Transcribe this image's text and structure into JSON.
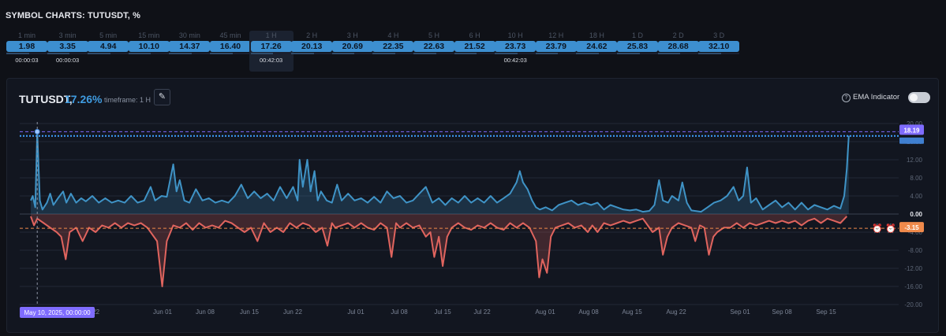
{
  "page": {
    "title": "SYMBOL CHARTS: TUTUSDT, %"
  },
  "timeframes": [
    {
      "label": "1 min",
      "value": "1.98",
      "timer": "00:00:03"
    },
    {
      "label": "3 min",
      "value": "3.35",
      "timer": "00:00:03"
    },
    {
      "label": "5 min",
      "value": "4.94",
      "timer": ""
    },
    {
      "label": "15 min",
      "value": "10.10",
      "timer": ""
    },
    {
      "label": "30 min",
      "value": "14.37",
      "timer": ""
    },
    {
      "label": "45 min",
      "value": "16.40",
      "timer": ""
    },
    {
      "label": "1 H",
      "value": "17.26",
      "timer": "00:42:03",
      "active": true
    },
    {
      "label": "2 H",
      "value": "20.13",
      "timer": ""
    },
    {
      "label": "3 H",
      "value": "20.69",
      "timer": ""
    },
    {
      "label": "4 H",
      "value": "22.35",
      "timer": ""
    },
    {
      "label": "5 H",
      "value": "22.63",
      "timer": ""
    },
    {
      "label": "6 H",
      "value": "21.52",
      "timer": ""
    },
    {
      "label": "10 H",
      "value": "23.73",
      "timer": "00:42:03"
    },
    {
      "label": "12 H",
      "value": "23.79",
      "timer": ""
    },
    {
      "label": "18 H",
      "value": "24.62",
      "timer": ""
    },
    {
      "label": "1 D",
      "value": "25.83",
      "timer": ""
    },
    {
      "label": "2 D",
      "value": "28.68",
      "timer": ""
    },
    {
      "label": "3 D",
      "value": "32.10",
      "timer": ""
    }
  ],
  "chart": {
    "symbol": "TUTUSDT,",
    "percent": "17.26%",
    "timeframe_label": "timeframe: 1 H",
    "ema_label": "EMA Indicator",
    "ema_enabled": false
  },
  "colors": {
    "positive": "#3f93c6",
    "negative": "#e0645e",
    "max_line": "#7f6cff",
    "current_line": "#3fa0ff",
    "min_line": "#f08a4b"
  },
  "icons": [
    "pen-icon",
    "info-icon",
    "alarm-add-icon",
    "alarm-remove-icon"
  ],
  "chart_data": {
    "type": "area",
    "x_start": "2025-05-10 00:00",
    "x_end": "2025-09-21 00:00",
    "y_ticks": [
      "20.00",
      "16.00",
      "12.00",
      "8.00",
      "4.00",
      "0.00",
      "-4.00",
      "-8.00",
      "-12.00",
      "-16.00",
      "-20.00"
    ],
    "ylim": [
      -20,
      20
    ],
    "x_ticks": [
      "May 22",
      "Jun 01",
      "Jun 08",
      "Jun 15",
      "Jun 22",
      "Jul 01",
      "Jul 08",
      "Jul 15",
      "Jul 22",
      "Aug 01",
      "Aug 08",
      "Aug 15",
      "Aug 22",
      "Sep 01",
      "Sep 08",
      "Sep 15"
    ],
    "crosshair_label": "May 10, 2025, 00:00:00",
    "max_value": 18.19,
    "max_label": "18.19",
    "current_value": 17.26,
    "min_value": -3.15,
    "min_label": "-3.15",
    "series": [
      {
        "sign": "positive",
        "points": [
          [
            0,
            3
          ],
          [
            0.3,
            4
          ],
          [
            0.7,
            1.5
          ],
          [
            1,
            18.2
          ],
          [
            1.4,
            3
          ],
          [
            1.8,
            1
          ],
          [
            2.5,
            2.5
          ],
          [
            3,
            4.5
          ],
          [
            3.5,
            2
          ],
          [
            4.2,
            3.5
          ],
          [
            5,
            5
          ],
          [
            5.5,
            2.5
          ],
          [
            6.2,
            4.5
          ],
          [
            7,
            2.5
          ],
          [
            7.8,
            3.5
          ],
          [
            8.5,
            2.8
          ],
          [
            9.5,
            4
          ],
          [
            10.5,
            2.5
          ],
          [
            11.5,
            3.5
          ],
          [
            12.5,
            2.5
          ],
          [
            13.5,
            3
          ],
          [
            14.5,
            2.5
          ],
          [
            15.5,
            4
          ],
          [
            16.5,
            2.5
          ],
          [
            17.5,
            3
          ],
          [
            18.5,
            6
          ],
          [
            19.2,
            3
          ],
          [
            20.2,
            4
          ],
          [
            21,
            3.8
          ],
          [
            22,
            11
          ],
          [
            22.5,
            5
          ],
          [
            23,
            7.5
          ],
          [
            23.7,
            3
          ],
          [
            24.5,
            2.5
          ],
          [
            25.5,
            5.5
          ],
          [
            26.5,
            3
          ],
          [
            27.5,
            3.5
          ],
          [
            28.5,
            2.5
          ],
          [
            29.5,
            3
          ],
          [
            30.5,
            2.5
          ],
          [
            31.5,
            4
          ],
          [
            32.5,
            6.5
          ],
          [
            33.5,
            3.5
          ],
          [
            34.5,
            5
          ],
          [
            35.5,
            3.5
          ],
          [
            36.5,
            4.5
          ],
          [
            37.5,
            3
          ],
          [
            38.5,
            6
          ],
          [
            39.5,
            3.5
          ],
          [
            40.5,
            6
          ],
          [
            41.2,
            3
          ],
          [
            41.5,
            12
          ],
          [
            42,
            6
          ],
          [
            42.7,
            12
          ],
          [
            43.2,
            5
          ],
          [
            43.8,
            9.5
          ],
          [
            44.3,
            3
          ],
          [
            44.8,
            5
          ],
          [
            45.7,
            3
          ],
          [
            46.5,
            2.5
          ],
          [
            47.3,
            6.5
          ],
          [
            48,
            3
          ],
          [
            49,
            4.5
          ],
          [
            50,
            3
          ],
          [
            51,
            3.5
          ],
          [
            52,
            2.5
          ],
          [
            53,
            3.8
          ],
          [
            54,
            2.5
          ],
          [
            55,
            5
          ],
          [
            56,
            3.5
          ],
          [
            57,
            4
          ],
          [
            58,
            2.5
          ],
          [
            59,
            3
          ],
          [
            60,
            4.5
          ],
          [
            61,
            6
          ],
          [
            62,
            2.5
          ],
          [
            63,
            3.5
          ],
          [
            64,
            2
          ],
          [
            65,
            3.5
          ],
          [
            66,
            2.5
          ],
          [
            67,
            4
          ],
          [
            68,
            2.5
          ],
          [
            69,
            3.5
          ],
          [
            70,
            2.5
          ],
          [
            71,
            4
          ],
          [
            72,
            2.5
          ],
          [
            73,
            3.5
          ],
          [
            74,
            4.5
          ],
          [
            75,
            7
          ],
          [
            75.5,
            9.5
          ],
          [
            76,
            7
          ],
          [
            76.7,
            5.5
          ],
          [
            77.4,
            3
          ],
          [
            78,
            1.5
          ],
          [
            78.6,
            1
          ],
          [
            79.5,
            1.5
          ],
          [
            80.5,
            0.8
          ],
          [
            81.5,
            2
          ],
          [
            82.5,
            2.5
          ],
          [
            83.5,
            3
          ],
          [
            84.5,
            2
          ],
          [
            85.5,
            2.5
          ],
          [
            86.5,
            2
          ],
          [
            87.5,
            2.5
          ],
          [
            88.5,
            1
          ],
          [
            89.5,
            2
          ],
          [
            90.5,
            1.5
          ],
          [
            91.5,
            1
          ],
          [
            92.5,
            0.8
          ],
          [
            93.5,
            1
          ],
          [
            94.5,
            0.5
          ],
          [
            95.5,
            0.7
          ],
          [
            96.3,
            2
          ],
          [
            97,
            7.5
          ],
          [
            97.6,
            3
          ],
          [
            98.4,
            2.5
          ],
          [
            99,
            4
          ],
          [
            100,
            3
          ],
          [
            100.6,
            7
          ],
          [
            101.3,
            2.5
          ],
          [
            102,
            0.8
          ],
          [
            103.5,
            0.5
          ],
          [
            104.5,
            1.5
          ],
          [
            105.5,
            2.5
          ],
          [
            106.5,
            3
          ],
          [
            107.5,
            4
          ],
          [
            108.5,
            6
          ],
          [
            109.3,
            3
          ],
          [
            110,
            4
          ],
          [
            110.6,
            10.3
          ],
          [
            111.2,
            2.5
          ],
          [
            112,
            3.5
          ],
          [
            113,
            1
          ],
          [
            114,
            2
          ],
          [
            115,
            3
          ],
          [
            116,
            1.5
          ],
          [
            117,
            2.5
          ],
          [
            118,
            1
          ],
          [
            119,
            2.5
          ],
          [
            120,
            1
          ],
          [
            121,
            2
          ],
          [
            122,
            1.5
          ],
          [
            123,
            1
          ],
          [
            124,
            1.8
          ],
          [
            125,
            1.2
          ],
          [
            125.6,
            4
          ],
          [
            126,
            10
          ],
          [
            126.3,
            17.3
          ]
        ]
      },
      {
        "sign": "negative",
        "points": [
          [
            0,
            -0.5
          ],
          [
            0.5,
            -2.5
          ],
          [
            1,
            -1
          ],
          [
            2,
            -2
          ],
          [
            3,
            -3
          ],
          [
            4,
            -4
          ],
          [
            4.7,
            -5
          ],
          [
            5.4,
            -10
          ],
          [
            6,
            -4
          ],
          [
            7,
            -3
          ],
          [
            8,
            -6
          ],
          [
            9,
            -3
          ],
          [
            10,
            -4
          ],
          [
            11,
            -2.5
          ],
          [
            12,
            -3
          ],
          [
            13,
            -2
          ],
          [
            14,
            -3
          ],
          [
            15,
            -2
          ],
          [
            16,
            -2.5
          ],
          [
            17,
            -2
          ],
          [
            18,
            -3
          ],
          [
            19.5,
            -6
          ],
          [
            20.3,
            -16
          ],
          [
            21,
            -6
          ],
          [
            22,
            -2.5
          ],
          [
            23,
            -3
          ],
          [
            24,
            -2
          ],
          [
            25,
            -3.5
          ],
          [
            26,
            -2
          ],
          [
            27,
            -3
          ],
          [
            28,
            -2.5
          ],
          [
            29,
            -3
          ],
          [
            30,
            -1.5
          ],
          [
            31,
            -2
          ],
          [
            32,
            -3
          ],
          [
            33,
            -4
          ],
          [
            34,
            -3
          ],
          [
            35,
            -6
          ],
          [
            36,
            -2
          ],
          [
            37,
            -4
          ],
          [
            38,
            -3
          ],
          [
            39,
            -4
          ],
          [
            40,
            -2
          ],
          [
            41,
            -3
          ],
          [
            42,
            -2
          ],
          [
            43,
            -2.5
          ],
          [
            44,
            -4
          ],
          [
            45,
            -3
          ],
          [
            45.8,
            -7
          ],
          [
            46.5,
            -2
          ],
          [
            47,
            -3
          ],
          [
            48,
            -2.5
          ],
          [
            49,
            -2
          ],
          [
            50,
            -3
          ],
          [
            51,
            -2
          ],
          [
            52,
            -3
          ],
          [
            53,
            -3.5
          ],
          [
            54,
            -2
          ],
          [
            55,
            -3
          ],
          [
            55.7,
            -9.5
          ],
          [
            56.4,
            -2
          ],
          [
            57,
            -3
          ],
          [
            58,
            -2
          ],
          [
            59,
            -3
          ],
          [
            60,
            -2.5
          ],
          [
            61,
            -5
          ],
          [
            61.7,
            -4
          ],
          [
            62.3,
            -9.5
          ],
          [
            63,
            -5
          ],
          [
            63.6,
            -11.5
          ],
          [
            64.3,
            -5
          ],
          [
            65,
            -3
          ],
          [
            66,
            -2
          ],
          [
            67,
            -3
          ],
          [
            68,
            -3.5
          ],
          [
            69,
            -2.5
          ],
          [
            70,
            -3
          ],
          [
            71,
            -2
          ],
          [
            72,
            -3
          ],
          [
            73,
            -3.5
          ],
          [
            74,
            -2
          ],
          [
            75,
            -3
          ],
          [
            76,
            -2
          ],
          [
            77,
            -3
          ],
          [
            78,
            -6
          ],
          [
            78.5,
            -14
          ],
          [
            79,
            -10
          ],
          [
            79.7,
            -13
          ],
          [
            80.3,
            -5
          ],
          [
            81,
            -3
          ],
          [
            82,
            -2.5
          ],
          [
            83,
            -2
          ],
          [
            84,
            -3
          ],
          [
            85,
            -2.5
          ],
          [
            86,
            -4
          ],
          [
            86.7,
            -2.5
          ],
          [
            87.5,
            -4
          ],
          [
            88.5,
            -2
          ],
          [
            89.5,
            -2.5
          ],
          [
            90.5,
            -2
          ],
          [
            91.5,
            -1.5
          ],
          [
            92.5,
            -2
          ],
          [
            93.5,
            -1.5
          ],
          [
            94.5,
            -1
          ],
          [
            95,
            -2
          ],
          [
            96,
            -4
          ],
          [
            97,
            -3
          ],
          [
            97.6,
            -9
          ],
          [
            98.3,
            -5
          ],
          [
            99,
            -3
          ],
          [
            100,
            -2
          ],
          [
            101,
            -2.5
          ],
          [
            102,
            -3
          ],
          [
            102.6,
            -6
          ],
          [
            103.3,
            -2.5
          ],
          [
            104,
            -3
          ],
          [
            104.7,
            -9
          ],
          [
            105.4,
            -5
          ],
          [
            106,
            -4
          ],
          [
            107,
            -3
          ],
          [
            108,
            -3
          ],
          [
            109,
            -2
          ],
          [
            110,
            -3
          ],
          [
            111,
            -2
          ],
          [
            112,
            -2.5
          ],
          [
            113,
            -2
          ],
          [
            114,
            -1.5
          ],
          [
            115,
            -2
          ],
          [
            116,
            -1.5
          ],
          [
            117,
            -2
          ],
          [
            118,
            -1.5
          ],
          [
            119,
            -2.5
          ],
          [
            120,
            -1.5
          ],
          [
            121,
            -1
          ],
          [
            122,
            -2
          ],
          [
            123,
            -1
          ],
          [
            124,
            -1.5
          ],
          [
            125,
            -2
          ],
          [
            126,
            -0.5
          ]
        ]
      }
    ],
    "x_unit": "days since May 10, 2025"
  }
}
